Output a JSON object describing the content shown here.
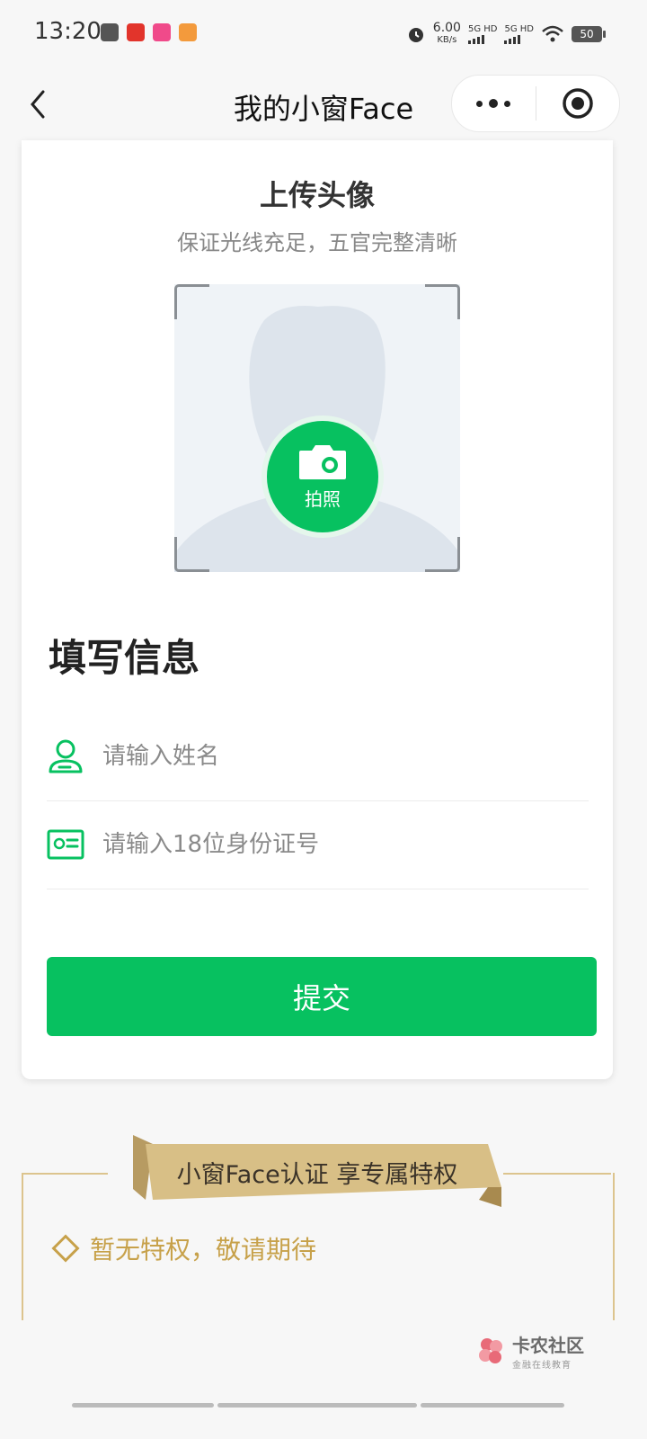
{
  "status_bar": {
    "time": "13:20",
    "speed": "6.00",
    "speed_unit": "KB/s",
    "sim1": "5G HD",
    "sim2": "5G HD",
    "battery": "50"
  },
  "nav": {
    "title": "我的小窗Face"
  },
  "upload": {
    "title": "上传头像",
    "subtitle": "保证光线充足，五官完整清晰",
    "camera_label": "拍照"
  },
  "form": {
    "title": "填写信息",
    "name_placeholder": "请输入姓名",
    "id_placeholder": "请输入18位身份证号",
    "submit_label": "提交"
  },
  "privilege": {
    "banner": "小窗Face认证 享专属特权",
    "item": "暂无特权，敬请期待"
  },
  "watermark": {
    "main": "卡农社区",
    "sub": "金融在线教育"
  },
  "colors": {
    "accent": "#07c160",
    "gold": "#c7a14a",
    "ribbon": "#d8bf86"
  },
  "icons": [
    "back-arrow-icon",
    "more-dots-icon",
    "target-icon",
    "camera-icon",
    "user-icon",
    "id-card-icon",
    "diamond-icon"
  ]
}
